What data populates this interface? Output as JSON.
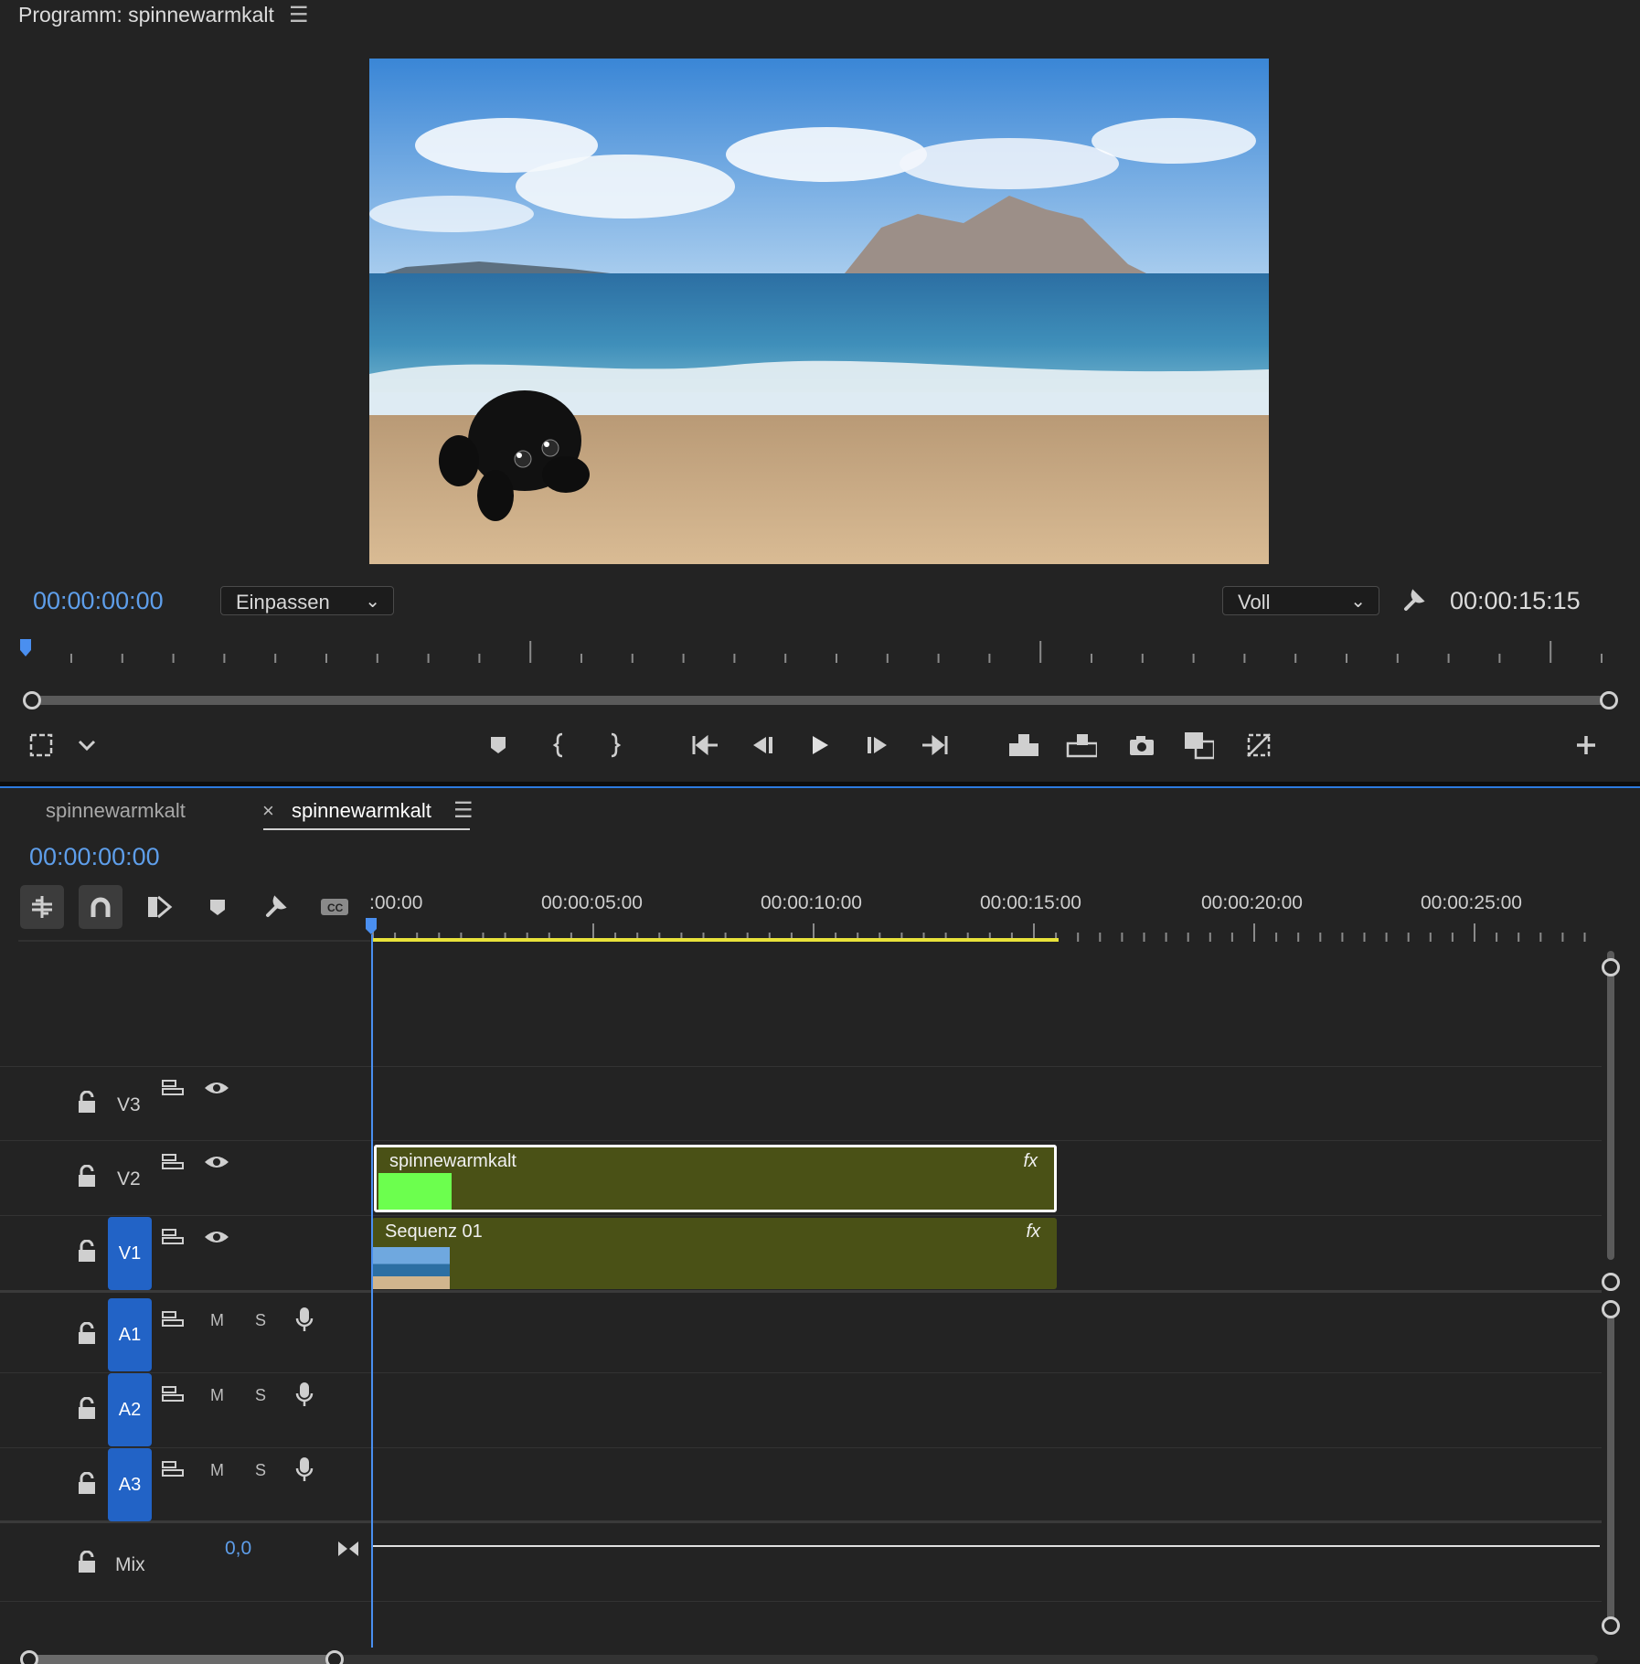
{
  "program": {
    "title": "Programm: spinnewarmkalt",
    "current_timecode": "00:00:00:00",
    "duration_timecode": "00:00:15:15",
    "zoom_select": "Einpassen",
    "quality_select": "Voll"
  },
  "timeline": {
    "tabs": [
      {
        "label": "spinnewarmkalt",
        "active": false
      },
      {
        "label": "spinnewarmkalt",
        "active": true
      }
    ],
    "close_glyph": "×",
    "timecode": "00:00:00:00",
    "ruler": [
      ":00:00",
      "00:00:05:00",
      "00:00:10:00",
      "00:00:15:00",
      "00:00:20:00",
      "00:00:25:00"
    ],
    "video_tracks": [
      {
        "name": "V3",
        "targeted": false
      },
      {
        "name": "V2",
        "targeted": false
      },
      {
        "name": "V1",
        "targeted": true
      }
    ],
    "audio_tracks": [
      {
        "name": "A1",
        "mute": "M",
        "solo": "S"
      },
      {
        "name": "A2",
        "mute": "M",
        "solo": "S"
      },
      {
        "name": "A3",
        "mute": "M",
        "solo": "S"
      }
    ],
    "mix": {
      "label": "Mix",
      "value": "0,0"
    },
    "clips": [
      {
        "track": "V2",
        "name": "spinnewarmkalt",
        "fx": "fx",
        "selected": true
      },
      {
        "track": "V1",
        "name": "Sequenz 01",
        "fx": "fx",
        "selected": false
      }
    ],
    "work_area_color": "#e8e23a",
    "playhead_color": "#4a8ff0",
    "clip_color": "#4a5116",
    "target_color": "#2263c6"
  },
  "icons": [
    "menu-icon",
    "wrench-icon",
    "marker-icon",
    "mark-in-icon",
    "mark-out-icon",
    "go-to-in-icon",
    "step-back-icon",
    "play-icon",
    "step-forward-icon",
    "go-to-out-icon",
    "lift-icon",
    "extract-icon",
    "camera-icon",
    "compare-icon",
    "overlay-icon",
    "add-icon",
    "lock-icon",
    "sync-lock-icon",
    "eye-icon",
    "mic-icon",
    "snap-icon",
    "linked-icon",
    "captions-icon"
  ]
}
